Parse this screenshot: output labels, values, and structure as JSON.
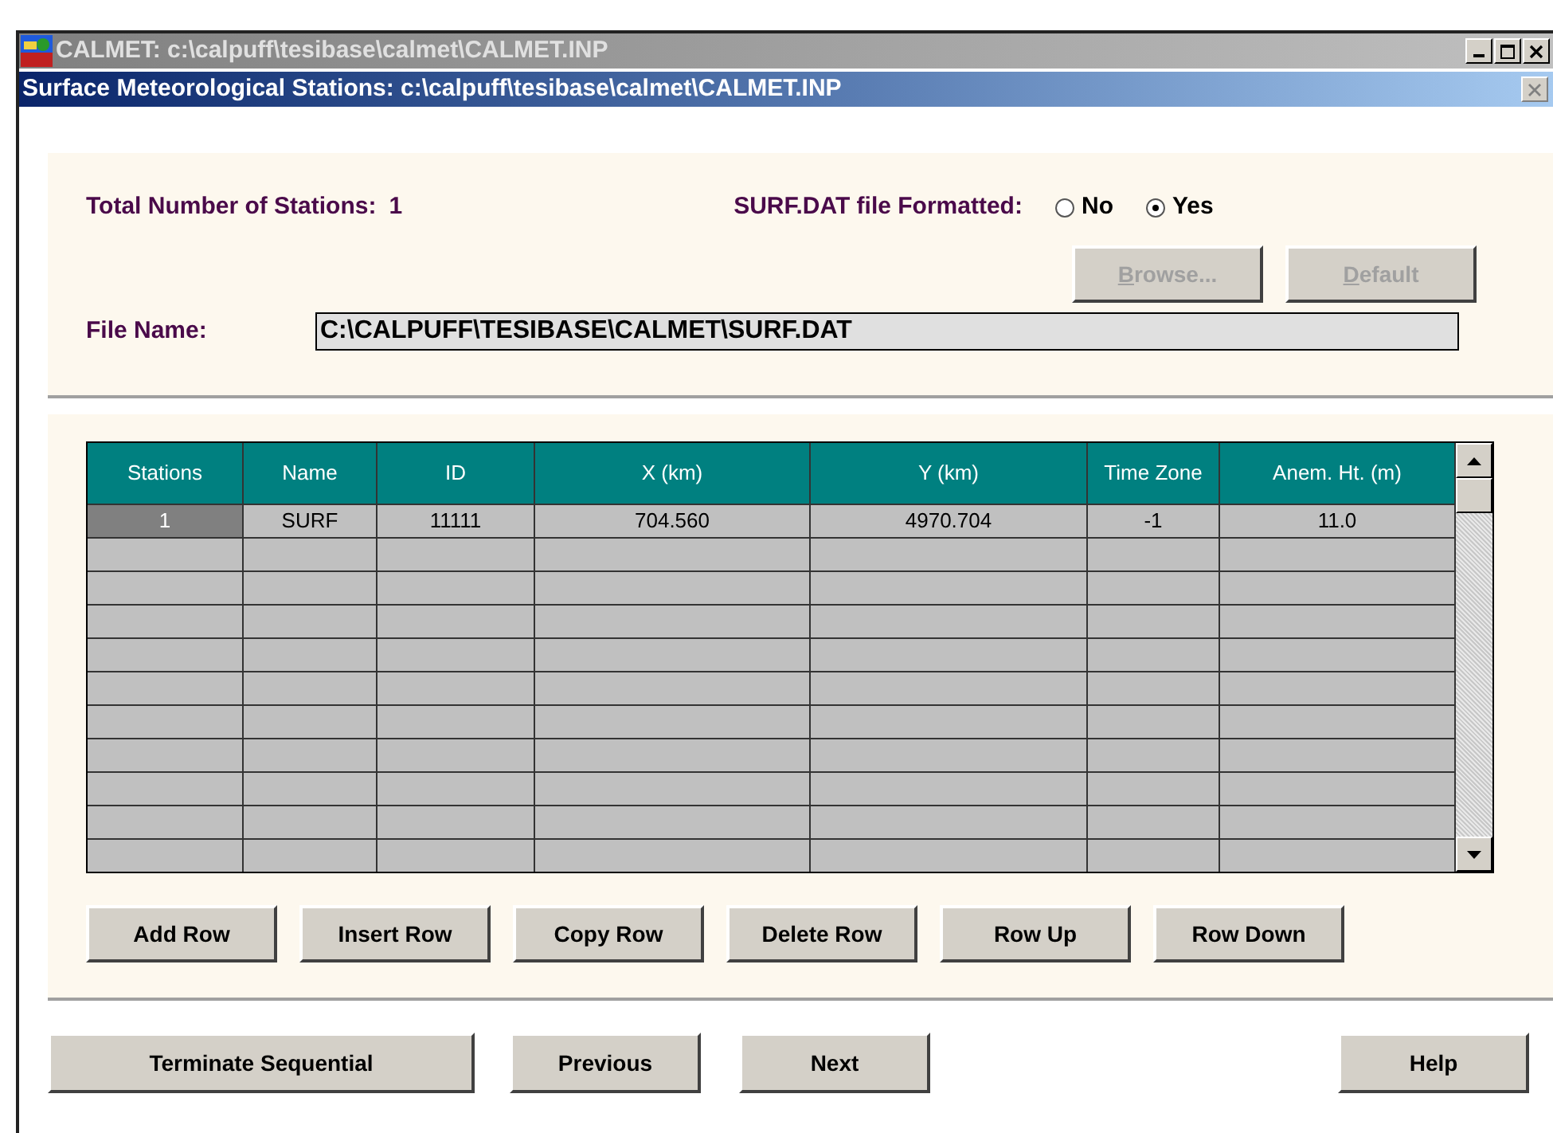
{
  "app_window": {
    "title": "CALMET: c:\\calpuff\\tesibase\\calmet\\CALMET.INP"
  },
  "dialog": {
    "title": "Surface Meteorological Stations: c:\\calpuff\\tesibase\\calmet\\CALMET.INP"
  },
  "total_stations": {
    "label": "Total Number of Stations:",
    "value": "1"
  },
  "formatted": {
    "label": "SURF.DAT file Formatted:",
    "options": [
      {
        "label": "No",
        "selected": false
      },
      {
        "label": "Yes",
        "selected": true
      }
    ]
  },
  "file_buttons": [
    {
      "label": "Browse...",
      "disabled": true
    },
    {
      "label": "Default",
      "disabled": true
    }
  ],
  "file_name": {
    "label": "File Name:",
    "value": "C:\\CALPUFF\\TESIBASE\\CALMET\\SURF.DAT"
  },
  "table": {
    "columns": [
      "Stations",
      "Name",
      "ID",
      "X (km)",
      "Y (km)",
      "Time Zone",
      "Anem. Ht. (m)"
    ],
    "rows": [
      {
        "selected": true,
        "cells": [
          "1",
          "SURF",
          "11111",
          "704.560",
          "4970.704",
          "-1",
          "11.0"
        ]
      }
    ]
  },
  "row_buttons": [
    "Add Row",
    "Insert Row",
    "Copy Row",
    "Delete Row",
    "Row Up",
    "Row Down"
  ],
  "nav_buttons": [
    "Terminate Sequential",
    "Previous",
    "Next",
    "Help"
  ]
}
